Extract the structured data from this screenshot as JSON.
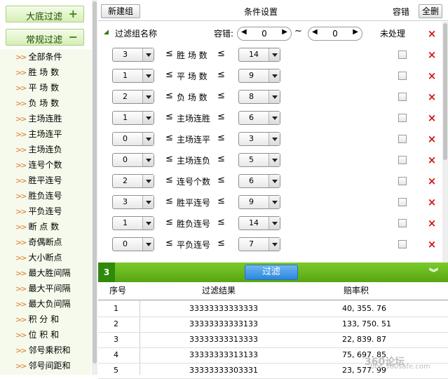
{
  "sidebar": {
    "header_big": {
      "label": "大底过滤",
      "symbol": "+"
    },
    "header_reg": {
      "label": "常规过滤",
      "symbol": "−"
    },
    "items": [
      "全部条件",
      "胜 场 数",
      "平 场 数",
      "负 场 数",
      "主场连胜",
      "主场连平",
      "主场连负",
      "连号个数",
      "胜平连号",
      "胜负连号",
      "平负连号",
      "断 点 数",
      "奇偶断点",
      "大小断点",
      "最大胜间隔",
      "最大平间隔",
      "最大负间隔",
      "积 分 和",
      "位 积 和",
      "邻号乘积和",
      "邻号间距和"
    ]
  },
  "toolbar": {
    "new_group": "新建组",
    "title": "条件设置",
    "error_label": "容错",
    "delete_all": "全删"
  },
  "group": {
    "name_label": "过滤组名称",
    "error_label": "容错:",
    "error_min": "0",
    "error_max": "0",
    "tilde": "~",
    "unprocessed": "未处理"
  },
  "filters": [
    {
      "min": "3",
      "label": "胜 场 数",
      "max": "14"
    },
    {
      "min": "1",
      "label": "平 场 数",
      "max": "9"
    },
    {
      "min": "2",
      "label": "负 场 数",
      "max": "8"
    },
    {
      "min": "1",
      "label": "主场连胜",
      "max": "6"
    },
    {
      "min": "0",
      "label": "主场连平",
      "max": "3"
    },
    {
      "min": "0",
      "label": "主场连负",
      "max": "5"
    },
    {
      "min": "2",
      "label": "连号个数",
      "max": "6"
    },
    {
      "min": "3",
      "label": "胜平连号",
      "max": "9"
    },
    {
      "min": "1",
      "label": "胜负连号",
      "max": "14"
    },
    {
      "min": "0",
      "label": "平负连号",
      "max": "7"
    }
  ],
  "symbols": {
    "le": "≤",
    "close": "×"
  },
  "filter_bar": {
    "count": "3",
    "button": "过滤",
    "collapse": "»"
  },
  "results": {
    "headers": [
      "序号",
      "过滤结果",
      "赔率积"
    ],
    "rows": [
      [
        "1",
        "33333333333333",
        "40, 355. 76"
      ],
      [
        "2",
        "33333333333133",
        "133, 750. 51"
      ],
      [
        "3",
        "33333333313333",
        "22, 839. 87"
      ],
      [
        "4",
        "33333333313133",
        "75, 697. 85"
      ],
      [
        "5",
        "33333333303331",
        "23, 577. 99"
      ]
    ]
  },
  "watermark": {
    "line1": "360论坛",
    "line2": "bbs.360safe.com"
  }
}
